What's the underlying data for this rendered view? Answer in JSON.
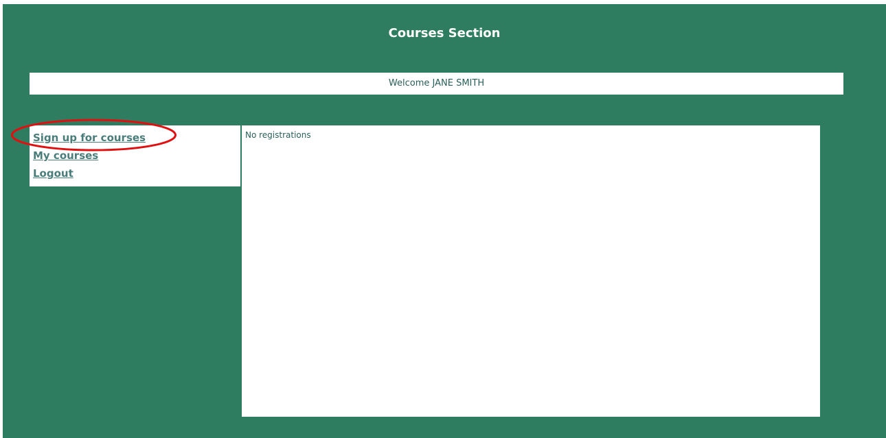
{
  "header": {
    "title": "Courses Section"
  },
  "welcome": {
    "text": "Welcome JANE SMITH"
  },
  "sidebar": {
    "items": [
      {
        "label": "Sign up for courses"
      },
      {
        "label": "My courses"
      },
      {
        "label": "Logout"
      }
    ]
  },
  "main": {
    "message": "No registrations"
  },
  "colors": {
    "background": "#2e7d60",
    "panel": "#ffffff",
    "link": "#4a7d7a",
    "text": "#2a5f5a",
    "annotation": "#e01010"
  }
}
